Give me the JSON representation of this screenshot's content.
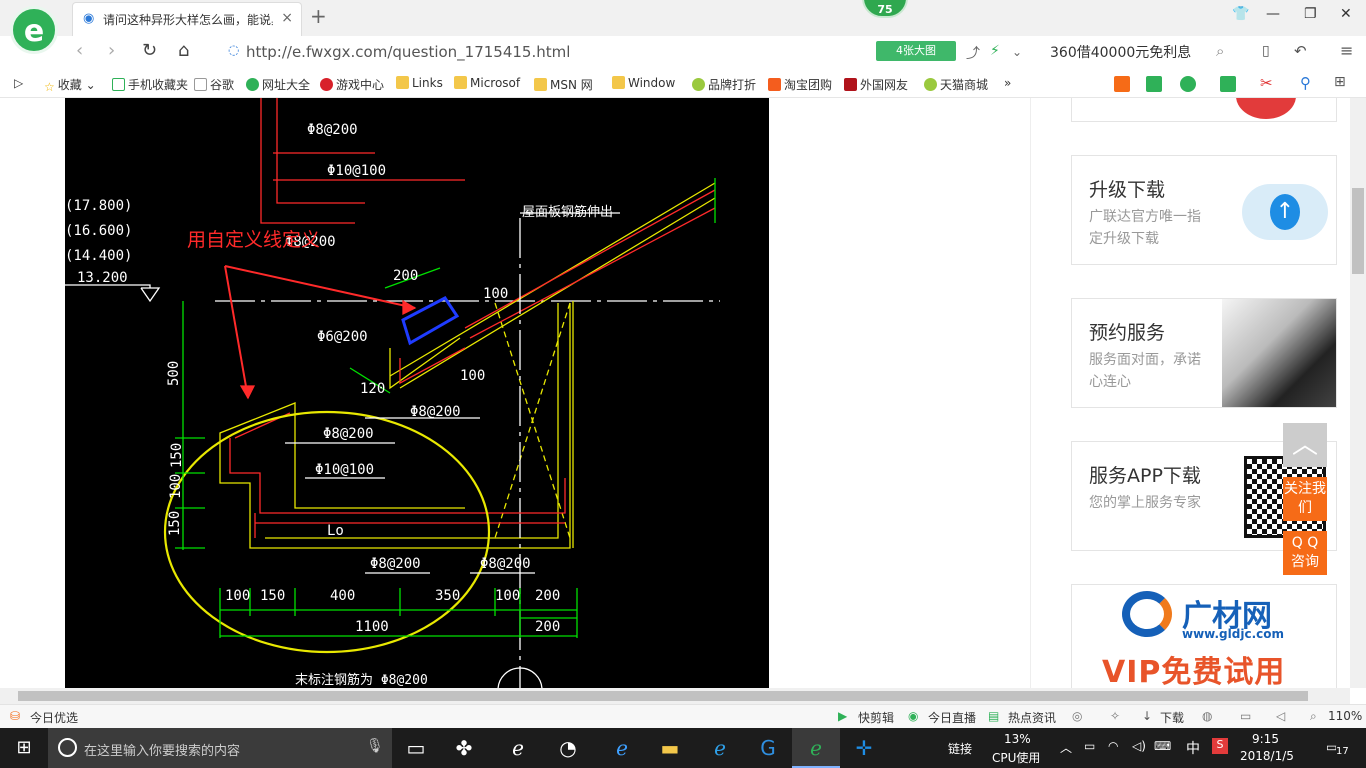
{
  "browser": {
    "logo": "e",
    "tab_title": "请问这种异形大样怎么画，能说具体点吗",
    "tab_close": "×",
    "new_tab": "+",
    "badge": "75",
    "url": "http://e.fwxgx.com/question_1715415.html",
    "big_image_button": "4张大图",
    "promo_text": "360借40000元免利息"
  },
  "bookmarks": [
    {
      "label": "收藏",
      "icon": "star-icon"
    },
    {
      "label": "手机收藏夹",
      "icon": "phone-icon"
    },
    {
      "label": "谷歌",
      "icon": "page-icon"
    },
    {
      "label": "网址大全",
      "icon": "web-icon"
    },
    {
      "label": "游戏中心",
      "icon": "game-icon"
    },
    {
      "label": "Links",
      "icon": "folder-icon"
    },
    {
      "label": "Microsof",
      "icon": "folder-icon"
    },
    {
      "label": "MSN 网",
      "icon": "folder-icon"
    },
    {
      "label": "Window",
      "icon": "folder-icon"
    },
    {
      "label": "品牌打折",
      "icon": "leaf-icon"
    },
    {
      "label": "淘宝团购",
      "icon": "taobao-icon"
    },
    {
      "label": "外国网友",
      "icon": "flag-icon"
    },
    {
      "label": "天猫商城",
      "icon": "leaf-icon"
    }
  ],
  "drawing": {
    "annotation": "用自定义线定义",
    "texts": {
      "elev1": "(17.800)",
      "elev2": "(16.600)",
      "elev3": "(14.400)",
      "elev4": "13.200",
      "r1": "Φ8@200",
      "r2": "Φ10@100",
      "r3": "Φ8@200",
      "roof": "屋面板钢筋伸出",
      "d200": "200",
      "d100a": "100",
      "d100b": "100",
      "d120": "120",
      "r6": "Φ6@200",
      "r8b": "Φ8@200",
      "r8c": "Φ8@200",
      "r10b": "Φ10@100",
      "lo": "Lo",
      "r8d": "Φ8@200",
      "r8e": "Φ8@200",
      "v500": "500",
      "v150a": "150",
      "v100": "100",
      "v150b": "150",
      "b100a": "100",
      "b150": "150",
      "b400": "400",
      "b350": "350",
      "b100b": "100",
      "b200a": "200",
      "b1100": "1100",
      "b200b": "200",
      "note": "末标注钢筋为 Φ8@200"
    }
  },
  "sidebar": {
    "cards": [
      {
        "title": "升级下载",
        "desc": "广联达官方唯一指定升级下载"
      },
      {
        "title": "预约服务",
        "desc": "服务面对面，承诺心连心"
      },
      {
        "title": "服务APP下载",
        "desc": "您的掌上服务专家"
      }
    ],
    "ad_brand": "广材网",
    "ad_url": "www.gldjc.com",
    "ad_slogan": "VIP免费试用",
    "float_follow": "关注我们",
    "float_qq": "Q Q 咨询"
  },
  "statusbar": {
    "left": "今日优选",
    "items": [
      "快剪辑",
      "今日直播",
      "热点资讯"
    ],
    "download": "下载",
    "zoom": "110%"
  },
  "taskbar": {
    "search_placeholder": "在这里输入你要搜索的内容",
    "links_label": "链接",
    "cpu_percent": "13%",
    "cpu_label": "CPU使用",
    "ime": "中",
    "time": "9:15",
    "date": "2018/1/5",
    "notifications": "17"
  },
  "colors": {
    "brand_green": "#2fb158",
    "cad_red": "#ff2a2a",
    "cad_green": "#00e000",
    "cad_yellow": "#e8e800",
    "cad_blue": "#1f3cff",
    "float_orange": "#f66b17"
  }
}
